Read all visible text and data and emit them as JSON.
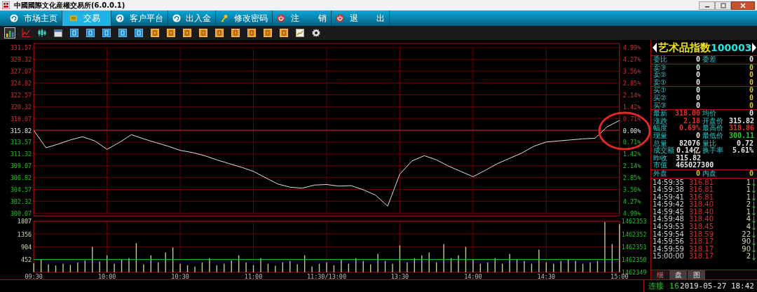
{
  "window": {
    "title": "中國國際文化産權交易所(6.0.0.1)"
  },
  "nav_tabs": [
    {
      "label": "市场主页",
      "selected": false
    },
    {
      "label": "交易",
      "selected": true
    },
    {
      "label": "客户平台",
      "selected": false
    },
    {
      "label": "出入金",
      "selected": false
    },
    {
      "label": "修改密码",
      "selected": false
    },
    {
      "label": "注       销",
      "selected": false
    },
    {
      "label": "退       出",
      "selected": false
    }
  ],
  "toolbar": [
    {
      "kind": "bars",
      "selected": true
    },
    {
      "kind": "line",
      "selected": false
    },
    {
      "kind": "candles",
      "selected": false
    },
    {
      "kind": "calendar",
      "selected": false
    },
    {
      "kind": "blue",
      "selected": false
    },
    {
      "kind": "blue",
      "selected": false
    },
    {
      "kind": "blue",
      "selected": false
    },
    {
      "kind": "blue",
      "selected": false
    },
    {
      "kind": "blue",
      "selected": false
    },
    {
      "kind": "orange",
      "selected": false
    },
    {
      "kind": "orange",
      "selected": false
    },
    {
      "kind": "orange",
      "selected": false
    },
    {
      "kind": "orange",
      "selected": false
    },
    {
      "kind": "orange",
      "selected": false
    },
    {
      "kind": "orange",
      "selected": false
    },
    {
      "kind": "orange",
      "selected": false
    },
    {
      "kind": "orange",
      "selected": false
    },
    {
      "kind": "orange",
      "selected": false
    },
    {
      "kind": "chart",
      "selected": false
    },
    {
      "kind": "gear",
      "selected": false
    }
  ],
  "price_chart": {
    "percent_labels": [
      "4.99%",
      "4.27%",
      "3.56%",
      "2.85%",
      "2.14%",
      "1.42%",
      "0.71%",
      "0.00%",
      "0.71%",
      "1.42%",
      "2.14%",
      "2.85%",
      "3.56%",
      "4.27%",
      "4.99%"
    ],
    "chart_data": {
      "type": "line",
      "grid": true,
      "ylim": [
        300.07,
        331.57
      ],
      "yticks": [
        {
          "value": 331.57,
          "label": "331.57"
        },
        {
          "value": 329.32,
          "label": "329.32"
        },
        {
          "value": 327.07,
          "label": "327.07"
        },
        {
          "value": 324.82,
          "label": "324.82"
        },
        {
          "value": 322.57,
          "label": "322.57"
        },
        {
          "value": 320.32,
          "label": "320.32"
        },
        {
          "value": 318.07,
          "label": "318.07"
        },
        {
          "value": 315.82,
          "label": "315.82"
        },
        {
          "value": 313.57,
          "label": "313.57"
        },
        {
          "value": 311.32,
          "label": "311.32"
        },
        {
          "value": 309.07,
          "label": "309.07"
        },
        {
          "value": 306.82,
          "label": "306.82"
        },
        {
          "value": 304.57,
          "label": "304.57"
        },
        {
          "value": 302.32,
          "label": "302.32"
        },
        {
          "value": 300.07,
          "label": "300.07"
        }
      ],
      "categories": [
        null,
        null,
        null,
        null,
        null,
        null,
        null,
        null,
        null,
        null,
        null,
        null,
        null,
        null,
        null,
        null,
        null,
        null,
        null,
        null,
        null,
        null,
        null,
        null,
        null,
        null,
        null,
        null,
        null,
        null,
        null,
        null,
        null,
        null,
        null,
        null,
        null,
        null,
        null,
        null,
        null,
        null,
        null,
        null,
        null,
        null,
        null,
        null,
        null
      ],
      "series": [
        {
          "color": "#e0e0e0",
          "values": [
            315.8,
            312.5,
            313.2,
            314.0,
            314.6,
            313.8,
            312.2,
            313.5,
            315.0,
            314.2,
            313.5,
            312.8,
            312.0,
            311.6,
            311.0,
            310.2,
            309.5,
            308.8,
            308.0,
            306.8,
            305.6,
            305.0,
            304.8,
            305.4,
            305.5,
            305.2,
            305.3,
            304.5,
            303.5,
            301.4,
            307.5,
            310.0,
            311.0,
            310.2,
            309.0,
            308.0,
            307.0,
            308.2,
            309.5,
            310.5,
            311.5,
            312.8,
            313.6,
            313.8,
            314.0,
            314.2,
            314.3,
            316.5,
            317.7
          ]
        }
      ],
      "ref_lines": [
        {
          "axis": "y",
          "value": 315.82
        }
      ]
    }
  },
  "volume_chart": {
    "right_labels": [
      "1462353",
      "1462352",
      "1462351",
      "1462350",
      "1462349"
    ],
    "chart_data": {
      "type": "bar",
      "grid": true,
      "ylim": [
        0,
        1807
      ],
      "yticks": [
        {
          "value": 1807,
          "label": "1807"
        },
        {
          "value": 1356,
          "label": "1356"
        },
        {
          "value": 904,
          "label": "904"
        },
        {
          "value": 452,
          "label": "452"
        }
      ],
      "categories": [
        "09:30",
        null,
        null,
        null,
        null,
        null,
        null,
        null,
        null,
        null,
        "10:00",
        null,
        null,
        null,
        null,
        null,
        null,
        null,
        null,
        null,
        "10:30",
        null,
        null,
        null,
        null,
        null,
        null,
        null,
        null,
        null,
        "11:00",
        null,
        null,
        null,
        null,
        null,
        null,
        null,
        null,
        null,
        "11:30/13:00",
        null,
        null,
        null,
        null,
        null,
        null,
        null,
        null,
        null,
        "13:30",
        null,
        null,
        null,
        null,
        null,
        null,
        null,
        null,
        null,
        "14:00",
        null,
        null,
        null,
        null,
        null,
        null,
        null,
        null,
        null,
        "14:30",
        null,
        null,
        null,
        null,
        null,
        null,
        null,
        null,
        null,
        "15:00"
      ],
      "series": [
        {
          "color": "#c8c890",
          "values": [
            320,
            450,
            280,
            240,
            300,
            260,
            350,
            420,
            900,
            380,
            600,
            300,
            450,
            500,
            1030,
            280,
            600,
            350,
            700,
            880,
            300,
            250,
            200,
            350,
            500,
            250,
            300,
            420,
            600,
            350,
            250,
            500,
            300,
            230,
            350,
            400,
            280,
            600,
            200,
            300,
            350,
            250,
            460,
            300,
            500,
            400,
            280,
            650,
            400,
            300,
            950,
            350,
            500,
            600,
            700,
            350,
            1000,
            500,
            600,
            900,
            450,
            300,
            350,
            500,
            300,
            650,
            450,
            400,
            300,
            800,
            350,
            300,
            400,
            450,
            400,
            300,
            350,
            400,
            1780,
            1000,
            1700
          ]
        }
      ],
      "ref_lines": [
        {
          "axis": "y",
          "value": 452
        }
      ]
    }
  },
  "overlay": {
    "kind": "circle"
  },
  "quote": {
    "name": "艺术品指数",
    "code": "100003",
    "book": [
      [
        {
          "label": "委比",
          "value": "0",
          "color": "#e8e8e8"
        },
        {
          "label": "委差",
          "value": "0",
          "color": "#e8e8e8"
        }
      ]
    ],
    "asks": [
      {
        "label": "卖③",
        "price": "0",
        "qty": "0"
      },
      {
        "label": "卖②",
        "price": "0",
        "qty": "0"
      },
      {
        "label": "卖①",
        "price": "0",
        "qty": "0"
      }
    ],
    "bids": [
      {
        "label": "买①",
        "price": "0",
        "qty": "0"
      },
      {
        "label": "买②",
        "price": "0",
        "qty": "0"
      },
      {
        "label": "买③",
        "price": "0",
        "qty": "0"
      }
    ],
    "stats": [
      [
        {
          "label": "最新",
          "value": "318.00",
          "color": "#e03030"
        },
        {
          "label": "均价",
          "value": "0",
          "color": "#e8e8e8"
        }
      ],
      [
        {
          "label": "涨跌",
          "value": "2.18",
          "color": "#e03030"
        },
        {
          "label": "开盘价",
          "value": "315.82",
          "color": "#e8e8e8"
        }
      ],
      [
        {
          "label": "幅度",
          "value": "0.69%",
          "color": "#e03030"
        },
        {
          "label": "最高价",
          "value": "318.86",
          "color": "#e03030"
        }
      ],
      [
        {
          "label": "现量",
          "value": "0",
          "color": "#e8e8e8"
        },
        {
          "label": "最低价",
          "value": "300.11",
          "color": "#20d020"
        }
      ],
      [
        {
          "label": "总量",
          "value": "82076",
          "color": "#e8e8e8"
        },
        {
          "label": "量比",
          "value": "0.72",
          "color": "#e8e8e8"
        }
      ],
      [
        {
          "label": "成交额",
          "value": "0.14亿",
          "color": "#e8e8e8"
        },
        {
          "label": "换手率",
          "value": "5.61%",
          "color": "#e8e8e8"
        }
      ],
      [
        {
          "label": "昨收",
          "value": "315.82",
          "color": "#e8e8e8"
        }
      ],
      [
        {
          "label": "市值",
          "value": "465027300",
          "color": "#e8e8e8"
        }
      ],
      [
        {
          "label": "外盘",
          "value": "0",
          "color": "#d8c020"
        },
        {
          "label": "内盘",
          "value": "0",
          "color": "#d8c020"
        }
      ]
    ],
    "trades": [
      {
        "time": "14:59:35",
        "price": "316.81",
        "qty": "1",
        "kind": "sell"
      },
      {
        "time": "14:59:38",
        "price": "316.81",
        "qty": "1",
        "kind": "sell"
      },
      {
        "time": "14:59:41",
        "price": "316.81",
        "qty": "1",
        "kind": "sell"
      },
      {
        "time": "14:59:42",
        "price": "318.40",
        "qty": "2",
        "kind": "sell"
      },
      {
        "time": "14:59:45",
        "price": "318.40",
        "qty": "1",
        "kind": "sell"
      },
      {
        "time": "14:59:48",
        "price": "318.40",
        "qty": "4",
        "kind": "sell"
      },
      {
        "time": "14:59:53",
        "price": "318.45",
        "qty": "4",
        "kind": "sell"
      },
      {
        "time": "14:59:54",
        "price": "318.59",
        "qty": "22",
        "kind": "sell"
      },
      {
        "time": "14:59:56",
        "price": "318.17",
        "qty": "90",
        "kind": "sell"
      },
      {
        "time": "14:59:59",
        "price": "318.17",
        "qty": "90",
        "kind": "sell"
      },
      {
        "time": "15:00:00",
        "price": "318.17",
        "qty": "2",
        "kind": "sell"
      }
    ],
    "tabs": [
      {
        "label": "细",
        "selected": true
      },
      {
        "label": "盘",
        "selected": false
      },
      {
        "label": "图",
        "selected": false
      }
    ]
  },
  "status_bar": {
    "connection": "连接",
    "count": "16",
    "datetime": "2019-05-27 18:42"
  }
}
